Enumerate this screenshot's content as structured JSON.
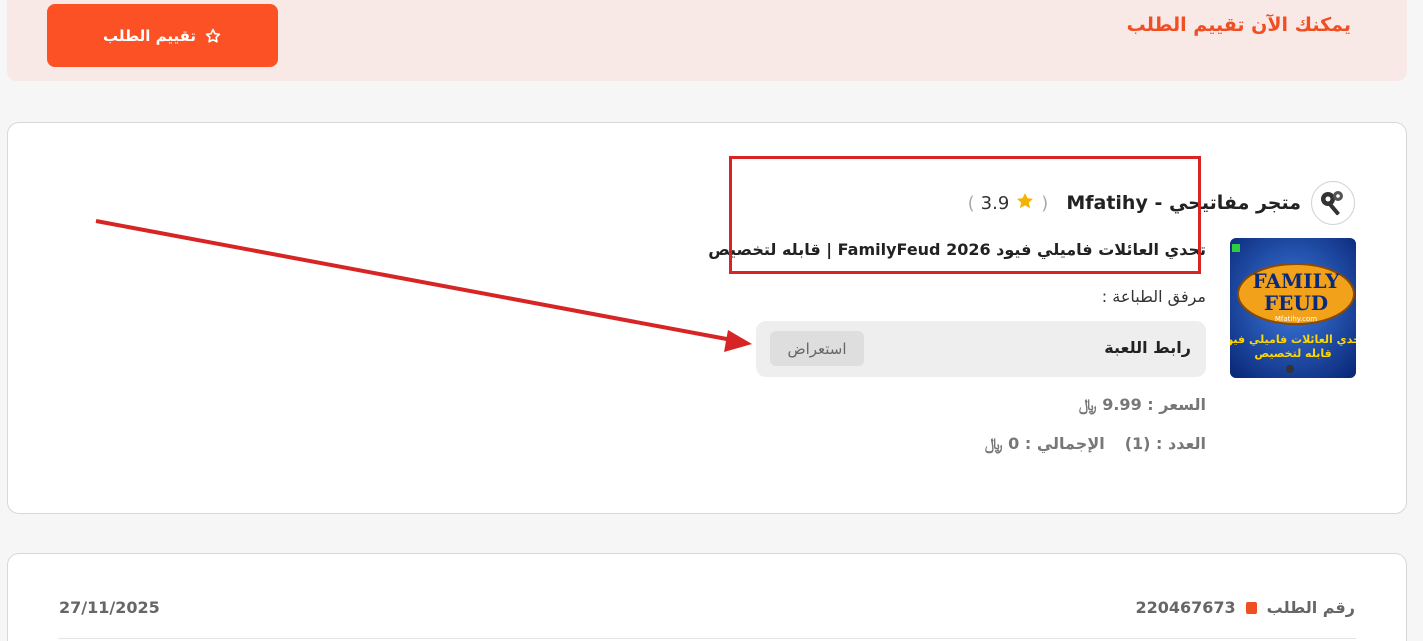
{
  "banner": {
    "text": "يمكنك الآن تقييم الطلب",
    "button_label": "تقييم الطلب"
  },
  "store": {
    "name": "متجر مفاتيحي - Mfatihy",
    "rating": "3.9",
    "paren_open": "(",
    "paren_close": ")"
  },
  "product": {
    "title": "تحدي العائلات فاميلي فيود FamilyFeud 2026 | قابله لتخصيص",
    "image_title_line1": "FAMILY",
    "image_title_line2": "FEUD",
    "image_site": "Mfatihy.com",
    "image_caption_line1": "تحدي العائلات فاميلي فيود",
    "image_caption_line2": "قابله لتخصيص",
    "attachment_label": "مرفق الطباعة :",
    "attachment_name": "رابط اللعبة",
    "view_label": "استعراض",
    "price": "السعر : 9.99 ﷼",
    "quantity": "العدد : (1)",
    "total": "الإجمالي : 0 ﷼"
  },
  "order": {
    "number_label": "رقم الطلب",
    "number": "220467673",
    "date": "27/11/2025"
  },
  "colors": {
    "accent": "#fc5124",
    "banner_bg": "#f8e8e6",
    "highlight": "#d72424"
  }
}
